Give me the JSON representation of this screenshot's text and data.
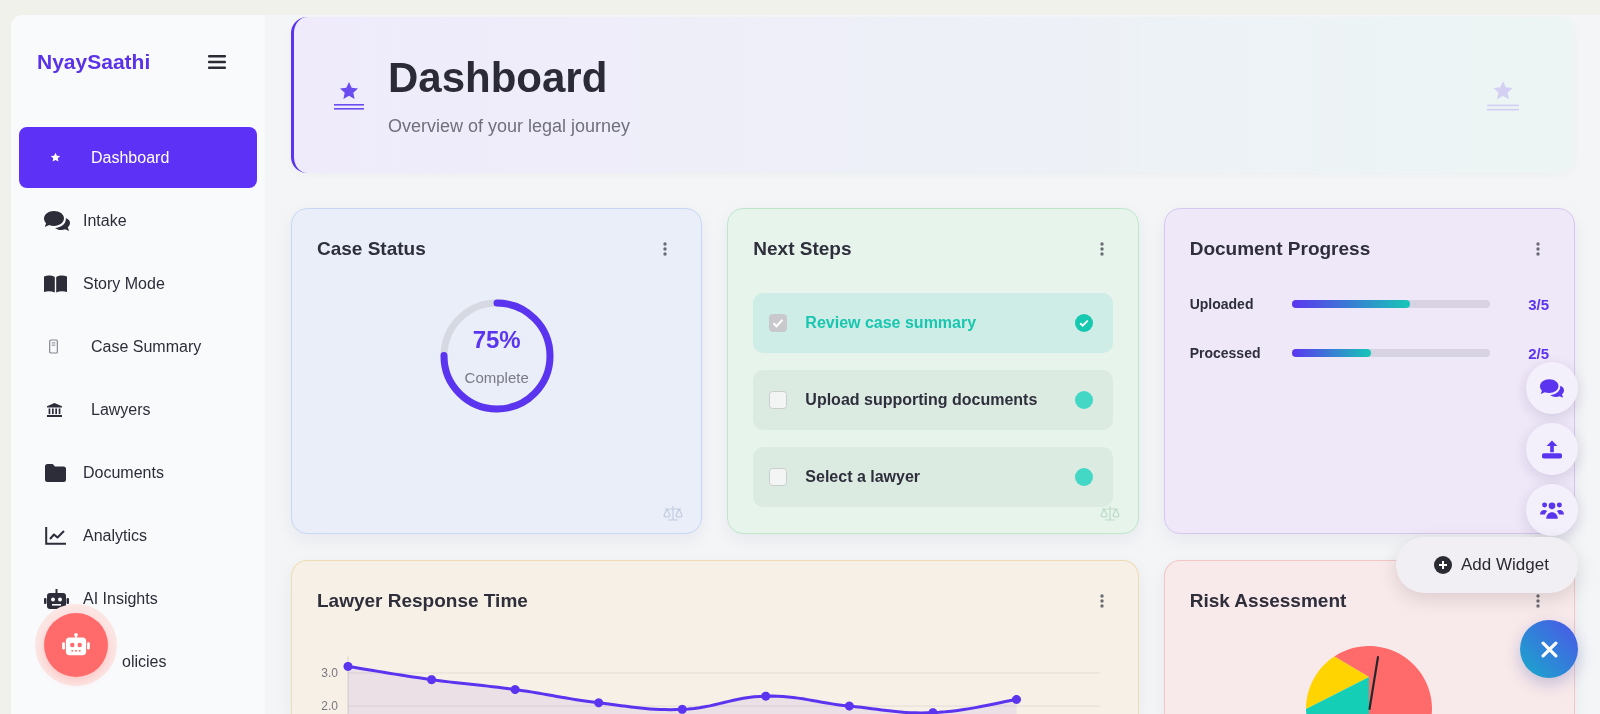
{
  "sidebar": {
    "logo": "NyaySaathi",
    "items": [
      {
        "label": "Dashboard",
        "selected": true
      },
      {
        "label": "Intake",
        "selected": false
      },
      {
        "label": "Story Mode",
        "selected": false
      },
      {
        "label": "Case Summary",
        "selected": false
      },
      {
        "label": "Lawyers",
        "selected": false
      },
      {
        "label": "Documents",
        "selected": false
      },
      {
        "label": "Analytics",
        "selected": false
      },
      {
        "label": "AI Insights",
        "selected": false
      },
      {
        "label": "olicies",
        "selected": false
      }
    ]
  },
  "header": {
    "title": "Dashboard",
    "subtitle": "Overview of your legal journey"
  },
  "case_status": {
    "title": "Case Status",
    "level": 0.75,
    "percent": "75%",
    "caption": "Complete"
  },
  "next_steps": {
    "title": "Next Steps",
    "steps": [
      {
        "label": "Review case summary",
        "checked": true
      },
      {
        "label": "Upload supporting documents",
        "checked": false
      },
      {
        "label": "Select a lawyer",
        "checked": false
      }
    ]
  },
  "document_progress": {
    "title": "Document Progress",
    "rows": [
      {
        "label": "Uploaded",
        "level": 0.6,
        "value": "3/5"
      },
      {
        "label": "Processed",
        "level": 0.4,
        "value": "2/5"
      }
    ]
  },
  "lawyer_response_time": {
    "title": "Lawyer Response Time",
    "chart_data": {
      "type": "area",
      "marker": true,
      "values": [
        3.2,
        2.8,
        2.5,
        2.1,
        1.9,
        2.3,
        2.0,
        1.8,
        2.2
      ],
      "ylim": [
        1.76,
        3.5
      ],
      "yticks": [
        {
          "value": 2,
          "label": "2.0"
        },
        {
          "value": 3,
          "label": "3.0"
        }
      ]
    }
  },
  "risk_assessment": {
    "title": "Risk Assessment"
  },
  "speed_dial": {
    "expanded": true,
    "label": "Add Widget"
  }
}
